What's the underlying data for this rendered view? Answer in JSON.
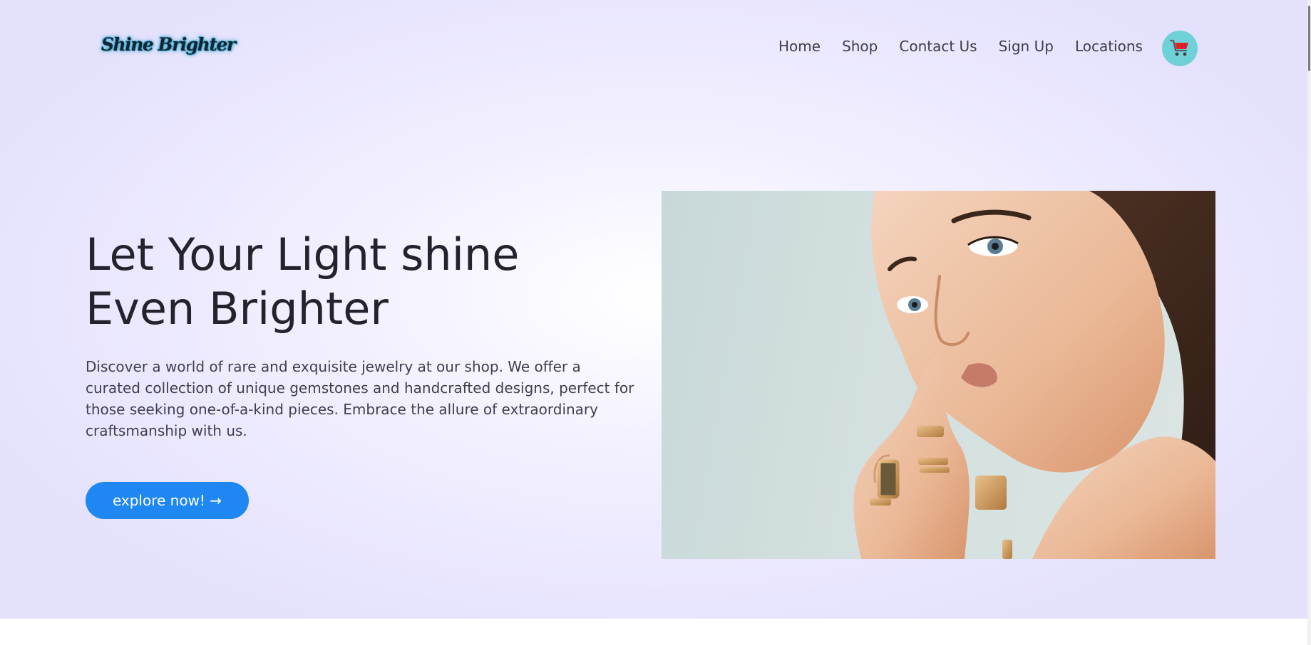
{
  "brand": {
    "logo_text": "Shine Brighter"
  },
  "nav": {
    "items": [
      "Home",
      "Shop",
      "Contact Us",
      "Sign Up",
      "Locations"
    ],
    "cart_icon": "shopping-cart-icon"
  },
  "hero": {
    "headline_line1": "Let Your Light shine",
    "headline_line2": "Even Brighter",
    "description": "Discover a world of rare and exquisite jewelry at our shop. We offer a curated collection of unique gemstones and handcrafted designs, perfect for those seeking one-of-a-kind pieces. Embrace the allure of extraordinary craftsmanship with us.",
    "cta_label": "explore now! →",
    "image_subject": "woman-with-gold-rings-photo"
  },
  "colors": {
    "hero_background": "#e4e1fd",
    "accent_blue": "#1e87f2",
    "cart_background": "#6fd1d8",
    "cart_icon": "#e4262b",
    "heading_text": "#24222c",
    "body_text": "#3f3e4a"
  }
}
